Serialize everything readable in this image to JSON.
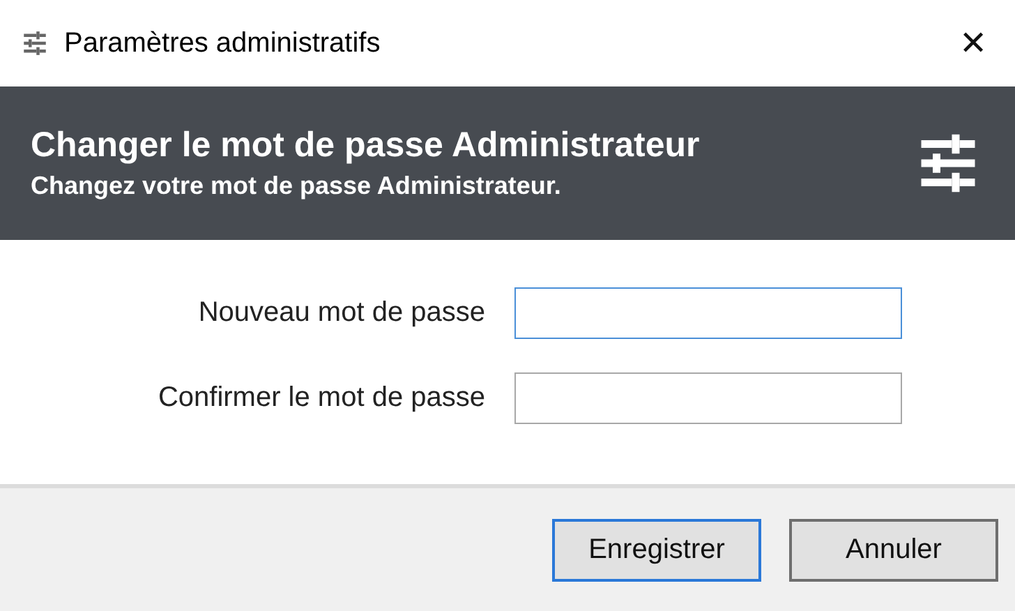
{
  "window": {
    "title": "Paramètres administratifs",
    "close": "✕"
  },
  "header": {
    "title": "Changer le mot de passe Administrateur",
    "subtitle": "Changez votre mot de passe Administrateur."
  },
  "fields": [
    {
      "label": "Nouveau mot de passe",
      "focused": true
    },
    {
      "label": "Confirmer le mot de passe",
      "focused": false
    }
  ],
  "buttons": [
    {
      "label": "Enregistrer",
      "default": true
    },
    {
      "label": "Annuler",
      "default": false
    }
  ]
}
